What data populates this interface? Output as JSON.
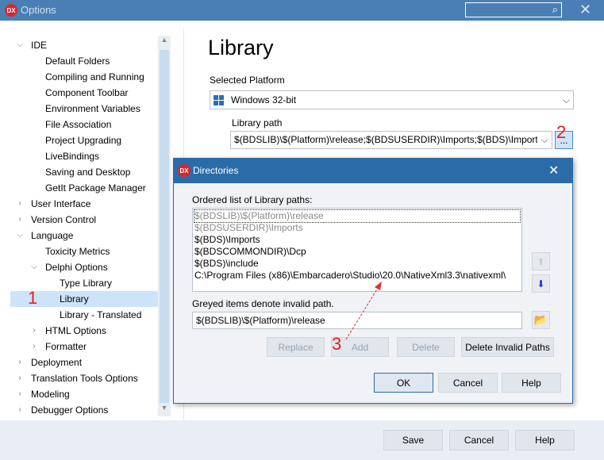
{
  "window": {
    "title": "Options",
    "logo": "DX"
  },
  "tree": [
    {
      "label": "IDE",
      "level": 0,
      "state": "expanded"
    },
    {
      "label": "Default Folders",
      "level": 1
    },
    {
      "label": "Compiling and Running",
      "level": 1
    },
    {
      "label": "Component Toolbar",
      "level": 1
    },
    {
      "label": "Environment Variables",
      "level": 1
    },
    {
      "label": "File Association",
      "level": 1
    },
    {
      "label": "Project Upgrading",
      "level": 1
    },
    {
      "label": "LiveBindings",
      "level": 1
    },
    {
      "label": "Saving and Desktop",
      "level": 1
    },
    {
      "label": "GetIt Package Manager",
      "level": 1
    },
    {
      "label": "User Interface",
      "level": 0,
      "state": "collapsed"
    },
    {
      "label": "Version Control",
      "level": 0,
      "state": "collapsed"
    },
    {
      "label": "Language",
      "level": 0,
      "state": "expanded"
    },
    {
      "label": "Toxicity Metrics",
      "level": 1
    },
    {
      "label": "Delphi Options",
      "level": 1,
      "state": "expanded"
    },
    {
      "label": "Type Library",
      "level": 2
    },
    {
      "label": "Library",
      "level": 2,
      "selected": true
    },
    {
      "label": "Library - Translated",
      "level": 2
    },
    {
      "label": "HTML Options",
      "level": 1,
      "state": "collapsed"
    },
    {
      "label": "Formatter",
      "level": 1,
      "state": "collapsed"
    },
    {
      "label": "Deployment",
      "level": 0,
      "state": "collapsed"
    },
    {
      "label": "Translation Tools Options",
      "level": 0,
      "state": "collapsed"
    },
    {
      "label": "Modeling",
      "level": 0,
      "state": "collapsed"
    },
    {
      "label": "Debugger Options",
      "level": 0,
      "state": "collapsed"
    }
  ],
  "main": {
    "heading": "Library",
    "platform_label": "Selected Platform",
    "platform_value": "Windows 32-bit",
    "library_path_label": "Library path",
    "library_path_value": "$(BDSLIB)\\$(Platform)\\release;$(BDSUSERDIR)\\Imports;$(BDS)\\Imports;$(BDS)\\include",
    "browse_label": "..."
  },
  "footer": {
    "save": "Save",
    "cancel": "Cancel",
    "help": "Help"
  },
  "dialog": {
    "title": "Directories",
    "logo": "DX",
    "list_label": "Ordered list of Library paths:",
    "paths": [
      {
        "text": "$(BDSLIB)\\$(Platform)\\release",
        "invalid": true
      },
      {
        "text": "$(BDSUSERDIR)\\Imports",
        "invalid": true
      },
      {
        "text": "$(BDS)\\Imports",
        "invalid": false
      },
      {
        "text": "$(BDSCOMMONDIR)\\Dcp",
        "invalid": false
      },
      {
        "text": "$(BDS)\\include",
        "invalid": false
      },
      {
        "text": "C:\\Program Files (x86)\\Embarcadero\\Studio\\20.0\\NativeXml3.3\\nativexml\\",
        "invalid": false
      }
    ],
    "hint": "Greyed items denote invalid path.",
    "edit_value": "$(BDSLIB)\\$(Platform)\\release",
    "replace": "Replace",
    "add": "Add",
    "delete": "Delete",
    "delete_invalid": "Delete Invalid Paths",
    "ok": "OK",
    "cancel": "Cancel",
    "help": "Help"
  },
  "annotations": {
    "one": "1",
    "two": "2",
    "three": "3"
  }
}
